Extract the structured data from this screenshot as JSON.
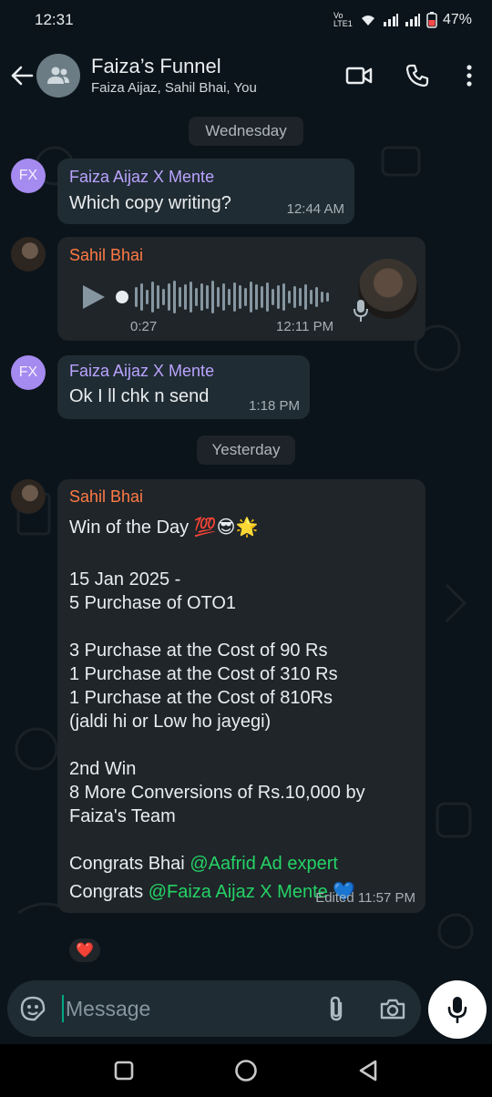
{
  "status_bar": {
    "time": "12:31",
    "network": "Vo LTE1",
    "battery": "47%"
  },
  "header": {
    "title": "Faiza’s Funnel",
    "members": "Faiza Aijaz, Sahil Bhai, You"
  },
  "dates": {
    "wednesday": "Wednesday",
    "yesterday": "Yesterday"
  },
  "messages": [
    {
      "avatar": "FX",
      "sender": "Faiza Aijaz X Mente",
      "text": "Which copy writing?",
      "time": "12:44 AM"
    },
    {
      "sender": "Sahil Bhai",
      "type": "voice",
      "duration": "0:27",
      "time": "12:11 PM"
    },
    {
      "avatar": "FX",
      "sender": "Faiza Aijaz X Mente",
      "text": "Ok I ll chk n send",
      "time": "1:18 PM"
    },
    {
      "sender": "Sahil Bhai",
      "lines": [
        "Win of the Day 💯😎🌟",
        "15 Jan 2025 -",
        "5 Purchase of OTO1",
        "3 Purchase at the Cost of 90 Rs",
        "1 Purchase at the Cost of 310 Rs",
        "1 Purchase at the Cost of 810Rs",
        "(jaldi hi or Low ho jayegi)",
        "2nd Win",
        "8 More Conversions of Rs.10,000 by",
        "Faiza's Team",
        "Congrats Bhai",
        "@Aafrid Ad expert",
        "Congrats",
        "@Faiza Aijaz X Mente",
        "💙"
      ],
      "time": "Edited 11:57 PM",
      "reaction": "❤️"
    }
  ],
  "composer": {
    "placeholder": "Message"
  },
  "icons": [
    "back-arrow-icon",
    "group-icon",
    "video-call-icon",
    "phone-icon",
    "more-icon",
    "play-icon",
    "mic-icon",
    "sticker-icon",
    "attach-icon",
    "camera-icon",
    "recents-icon",
    "home-icon",
    "back-icon"
  ],
  "colors": {
    "accent": "#25d366",
    "sender_purple": "#b9a3ff",
    "sender_orange": "#ff7a45",
    "bubble": "#202c33"
  }
}
